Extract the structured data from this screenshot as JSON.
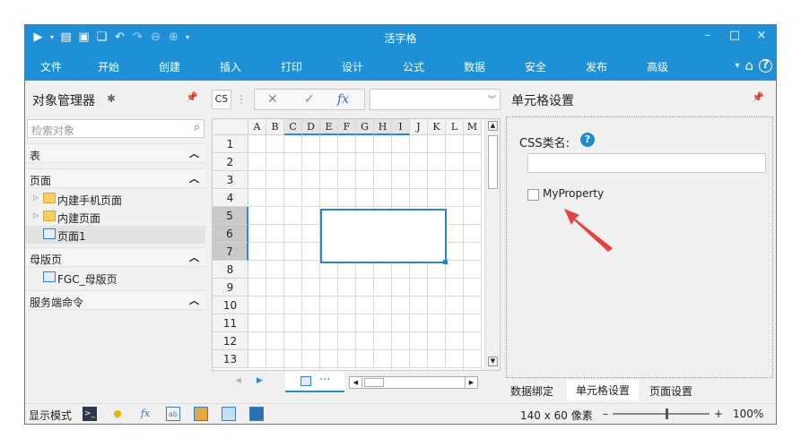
{
  "app": {
    "title": "活字格"
  },
  "titlebar": {
    "minimize": "–",
    "maximize": "□",
    "close": "×"
  },
  "menu": {
    "items": [
      "文件",
      "开始",
      "创建",
      "插入",
      "打印",
      "设计",
      "公式",
      "数据",
      "安全",
      "发布",
      "高级"
    ],
    "help": "?"
  },
  "object_manager": {
    "title": "对象管理器",
    "search_placeholder": "检索对象",
    "sections": {
      "table": "表",
      "page": "页面",
      "master": "母版页",
      "server": "服务端命令"
    },
    "tree": {
      "mobile_builtin": "内建手机页面",
      "builtin": "内建页面",
      "page1": "页面1",
      "master_page": "FGC_母版页"
    }
  },
  "formula_bar": {
    "cell_ref": "C5",
    "dots": "⋮",
    "cancel": "✕",
    "confirm": "✓",
    "fx": "fx"
  },
  "grid": {
    "columns": [
      "A",
      "B",
      "C",
      "D",
      "E",
      "F",
      "G",
      "H",
      "I",
      "J",
      "K",
      "L",
      "M"
    ],
    "rows": [
      "1",
      "2",
      "3",
      "4",
      "5",
      "6",
      "7",
      "8",
      "9",
      "10",
      "11",
      "12",
      "13"
    ],
    "sheet_dots": "···"
  },
  "cell_settings": {
    "title": "单元格设置",
    "css_label": "CSS类名:",
    "help": "?",
    "css_value": "",
    "checkbox_label": "MyProperty",
    "tabs": [
      "数据绑定",
      "单元格设置",
      "页面设置"
    ]
  },
  "status": {
    "mode": "显示模式",
    "dimensions": "140 x 60 像素",
    "zoom": "100%",
    "zoom_minus": "–",
    "zoom_plus": "+"
  },
  "colors": {
    "accent": "#1e90d8",
    "annotation_arrow": "#e8403a"
  }
}
